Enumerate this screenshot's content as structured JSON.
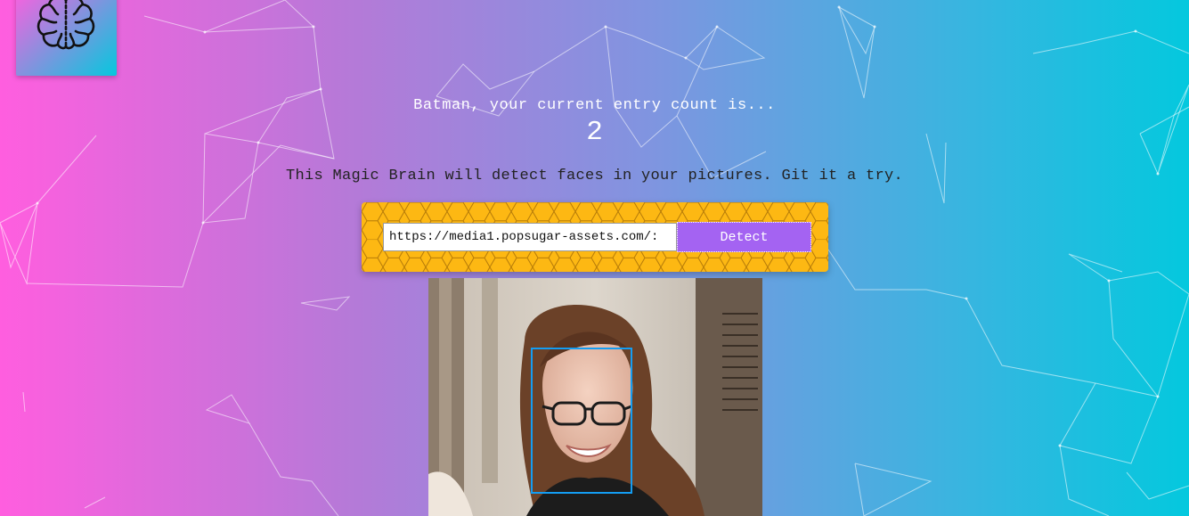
{
  "app": {
    "logo_icon": "brain-icon"
  },
  "rank": {
    "greeting": "Batman, your current entry count is...",
    "count": "2"
  },
  "tagline": "This Magic Brain will detect faces in your pictures. Git it a try.",
  "form": {
    "url_value": "https://media1.popsugar-assets.com/:",
    "detect_label": "Detect"
  },
  "colors": {
    "gradient_left": "#ff5edf",
    "gradient_right": "#04c8de",
    "panel": "#fdb813",
    "button": "#a463f2",
    "face_box": "#149df2"
  }
}
